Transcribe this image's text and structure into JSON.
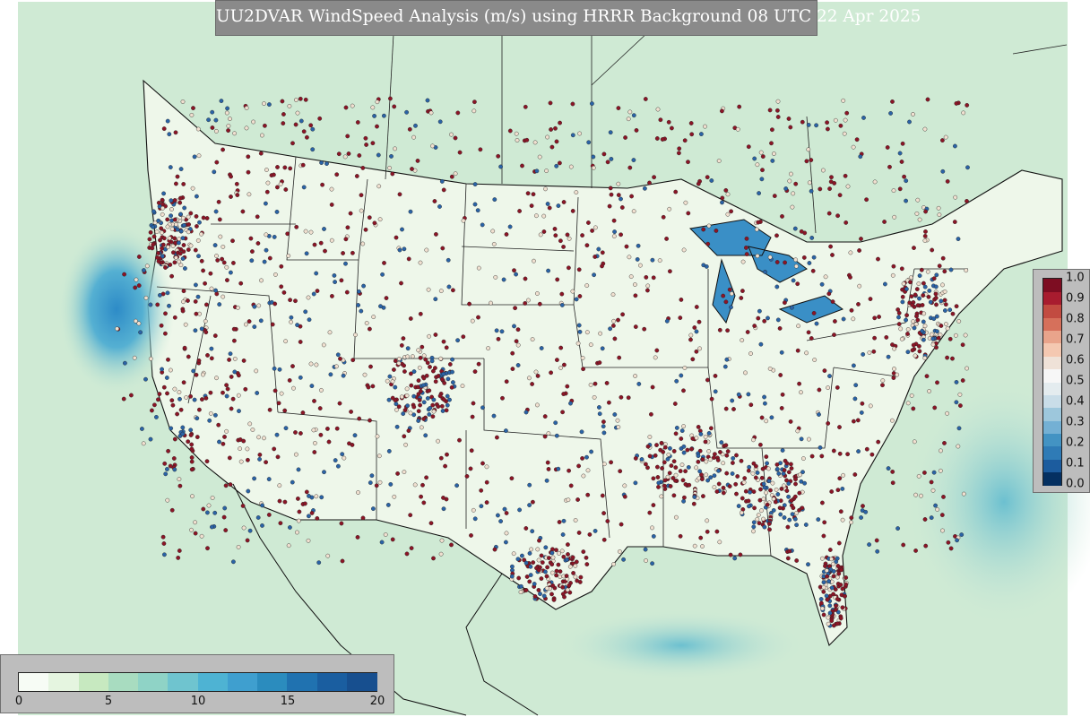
{
  "title": "UU2DVAR WindSpeed Analysis (m/s) using HRRR Background 08 UTC 22 Apr 2025",
  "colorbar_speed": {
    "ticks": [
      "0",
      "5",
      "10",
      "15",
      "20"
    ],
    "colors": [
      "#f7fcf5",
      "#e5f5e0",
      "#c7e9c0",
      "#a8dcc0",
      "#8fd3c6",
      "#6fc4cf",
      "#4eb3d3",
      "#3f9fcf",
      "#2b8cbe",
      "#2072b0",
      "#1a5ea0",
      "#174f8f"
    ]
  },
  "colorbar_ratio": {
    "ticks": [
      "1.0",
      "0.9",
      "0.8",
      "0.7",
      "0.6",
      "0.5",
      "0.4",
      "0.3",
      "0.2",
      "0.1",
      "0.0"
    ],
    "colors": [
      "#053061",
      "#1c5c9e",
      "#2f7bb6",
      "#4393c3",
      "#74b0d4",
      "#9dc7dc",
      "#c9dde8",
      "#e4ecef",
      "#f7f7f7",
      "#efe2d8",
      "#f4c8b1",
      "#e9a48b",
      "#d6705b",
      "#c24b41",
      "#a81c2f",
      "#7d0d22"
    ]
  },
  "palette": {
    "ocean_light": "#d8eed6",
    "land": "#eef7ea",
    "deep_water": "#4aa3d0",
    "dot_red": "#8b1526",
    "dot_blue": "#2a63a6",
    "dot_pale": "#f0e0d0"
  }
}
